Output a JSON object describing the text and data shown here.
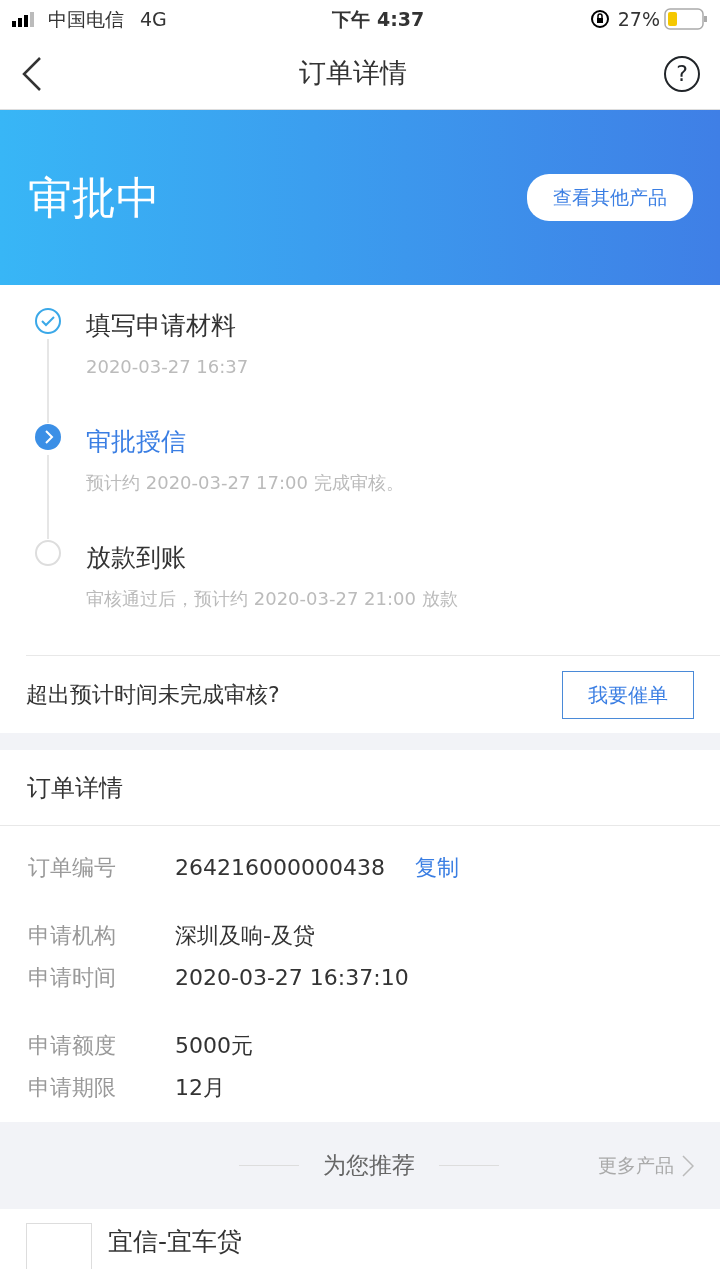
{
  "status_bar": {
    "carrier": "中国电信",
    "network": "4G",
    "time": "下午 4:37",
    "battery_percent": "27%"
  },
  "nav": {
    "title": "订单详情",
    "help": "?"
  },
  "banner": {
    "status": "审批中",
    "button": "查看其他产品"
  },
  "steps": [
    {
      "kind": "done",
      "title": "填写申请材料",
      "note": "2020-03-27 16:37"
    },
    {
      "kind": "current",
      "title": "审批授信",
      "note": "预计约 2020-03-27 17:00 完成审核。"
    },
    {
      "kind": "pending",
      "title": "放款到账",
      "note": "审核通过后，预计约 2020-03-27 21:00 放款"
    }
  ],
  "urge": {
    "question": "超出预计时间未完成审核?",
    "button": "我要催单"
  },
  "order": {
    "title": "订单详情",
    "groups": [
      [
        {
          "label": "订单编号",
          "value": "264216000000438",
          "action": "复制"
        }
      ],
      [
        {
          "label": "申请机构",
          "value": "深圳及响-及贷"
        },
        {
          "label": "申请时间",
          "value": "2020-03-27 16:37:10"
        }
      ],
      [
        {
          "label": "申请额度",
          "value": "5000元"
        },
        {
          "label": "申请期限",
          "value": "12月"
        }
      ]
    ]
  },
  "recommend": {
    "title": "为您推荐",
    "more": "更多产品"
  },
  "products": [
    {
      "name": "宜信-宜车贷"
    }
  ]
}
